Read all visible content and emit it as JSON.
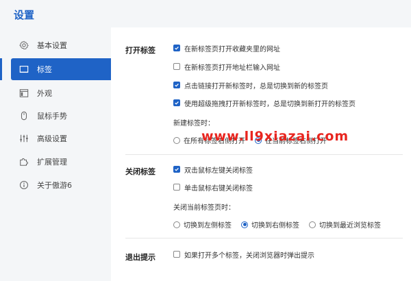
{
  "header": {
    "title": "设置"
  },
  "sidebar": {
    "items": [
      {
        "label": "基本设置",
        "icon": "gear-icon"
      },
      {
        "label": "标签",
        "icon": "tab-icon",
        "active": true
      },
      {
        "label": "外观",
        "icon": "window-icon"
      },
      {
        "label": "鼠标手势",
        "icon": "mouse-icon"
      },
      {
        "label": "高级设置",
        "icon": "sliders-icon"
      },
      {
        "label": "扩展管理",
        "icon": "puzzle-icon"
      },
      {
        "label": "关于傲游6",
        "icon": "info-icon"
      }
    ]
  },
  "sections": {
    "open_tabs": {
      "title": "打开标签",
      "options": [
        {
          "label": "在新标签页打开收藏夹里的网址",
          "checked": true
        },
        {
          "label": "在新标签页打开地址栏输入网址",
          "checked": false
        },
        {
          "label": "点击链接打开新标签时，总是切换到新的标签页",
          "checked": true
        },
        {
          "label": "使用超级拖拽打开新标签时，总是切换到新打开的标签页",
          "checked": true
        }
      ],
      "new_tab_label": "新建标签时：",
      "new_tab_options": [
        {
          "label": "在所有标签右侧打开",
          "selected": false
        },
        {
          "label": "在当前标签右侧打开",
          "selected": true
        }
      ]
    },
    "close_tabs": {
      "title": "关闭标签",
      "options": [
        {
          "label": "双击鼠标左键关闭标签",
          "checked": true
        },
        {
          "label": "单击鼠标右键关闭标签",
          "checked": false
        }
      ],
      "close_current_label": "关闭当前标签页时：",
      "close_current_options": [
        {
          "label": "切换到左侧标签",
          "selected": false
        },
        {
          "label": "切换到右侧标签",
          "selected": true
        },
        {
          "label": "切换到最近浏览标签",
          "selected": false
        }
      ]
    },
    "exit_prompt": {
      "title": "退出提示",
      "options": [
        {
          "label": "如果打开多个标签，关闭浏览器时弹出提示",
          "checked": false
        }
      ]
    }
  },
  "watermark": "www.ll9xiazai.com",
  "colors": {
    "accent": "#1f63c6",
    "watermark": "#e8251f"
  }
}
